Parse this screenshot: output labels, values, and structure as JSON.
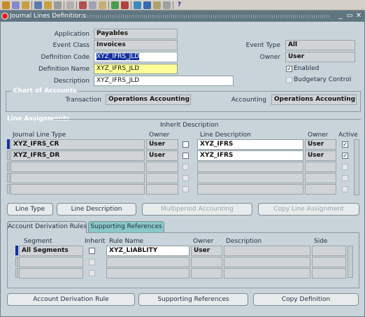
{
  "window": {
    "title": "Journal Lines Definitions"
  },
  "header": {
    "application_label": "Application",
    "application_value": "Payables",
    "event_class_label": "Event Class",
    "event_class_value": "Invoices",
    "definition_code_label": "Definition Code",
    "definition_code_value": "XYZ_IFRS_JLD",
    "definition_name_label": "Definition Name",
    "definition_name_value": "XYZ_IFRS_JLD",
    "description_label": "Description",
    "description_value": "XYZ_IFRS_JLD",
    "event_type_label": "Event Type",
    "event_type_value": "All",
    "owner_label": "Owner",
    "owner_value": "User",
    "enabled_label": "Enabled",
    "enabled": true,
    "budgetary_label": "Budgetary Control",
    "budgetary": false
  },
  "chart_of_accounts": {
    "title": "Chart of Accounts",
    "transaction_label": "Transaction",
    "transaction_value": "Operations Accounting Fle",
    "accounting_label": "Accounting",
    "accounting_value": "Operations Accounting Fle"
  },
  "line_assignments": {
    "title": "Line Assignments",
    "inherit_header": "Inherit Description",
    "col_journal_line_type": "Journal Line Type",
    "col_owner": "Owner",
    "col_line_description": "Line Description",
    "col_owner2": "Owner",
    "col_active": "Active",
    "rows": [
      {
        "jlt": "XYZ_IFRS_CR",
        "owner": "User",
        "inherit": false,
        "desc": "XYZ_IFRS",
        "owner2": "User",
        "active": true
      },
      {
        "jlt": "XYZ_IFRS_DR",
        "owner": "User",
        "inherit": false,
        "desc": "XYZ_IFRS",
        "owner2": "User",
        "active": true
      },
      {
        "jlt": "",
        "owner": "",
        "inherit": false,
        "desc": "",
        "owner2": "",
        "active": false
      },
      {
        "jlt": "",
        "owner": "",
        "inherit": false,
        "desc": "",
        "owner2": "",
        "active": false
      },
      {
        "jlt": "",
        "owner": "",
        "inherit": false,
        "desc": "",
        "owner2": "",
        "active": false
      }
    ]
  },
  "buttons": {
    "line_type": "Line Type",
    "line_description": "Line Description",
    "multiperiod": "Multiperiod Accounting",
    "copy_line": "Copy Line Assignment"
  },
  "tabs": {
    "account_derivation": "Account Derivation Rules",
    "supporting_refs": "Supporting References"
  },
  "rules": {
    "col_segment": "Segment",
    "col_inherit": "Inherit",
    "col_rule_name": "Rule Name",
    "col_owner": "Owner",
    "col_description": "Description",
    "col_side": "Side",
    "rows": [
      {
        "segment": "All Segments",
        "inherit": false,
        "rule": "XYZ_LIABLITY",
        "owner": "User",
        "description": "",
        "side": ""
      },
      {
        "segment": "",
        "inherit": false,
        "rule": "",
        "owner": "",
        "description": "",
        "side": ""
      },
      {
        "segment": "",
        "inherit": false,
        "rule": "",
        "owner": "",
        "description": "",
        "side": ""
      }
    ]
  },
  "bottom_buttons": {
    "account_derivation_rule": "Account Derivation Rule",
    "supporting_references": "Supporting References",
    "copy_definition": "Copy Definition"
  },
  "colors": {
    "title_bar": "#5f7580",
    "window_bg": "#c9d4da",
    "selection": "#1430a0",
    "highlight": "#ffff99"
  }
}
